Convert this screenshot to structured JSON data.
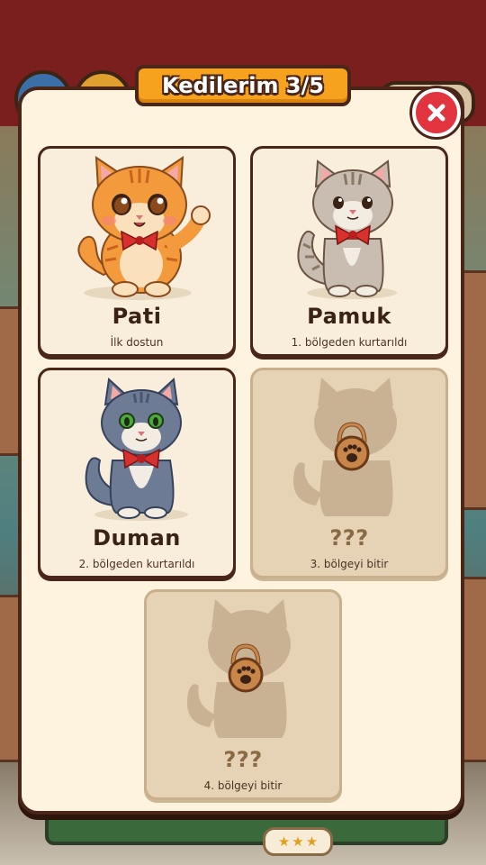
{
  "modal": {
    "title": "Kedilerim 3/5"
  },
  "cats": [
    {
      "name": "Pati",
      "subtitle": "İlk dostun",
      "locked": false,
      "fur": "#f29a3c",
      "eyes": "#8a4a1c"
    },
    {
      "name": "Pamuk",
      "subtitle": "1. bölgeden kurtarıldı",
      "locked": false,
      "fur": "#c8bdb0",
      "eyes": "#6a4a30"
    },
    {
      "name": "Duman",
      "subtitle": "2. bölgeden kurtarıldı",
      "locked": false,
      "fur": "#6d7c94",
      "eyes": "#4caa3c"
    },
    {
      "name": "???",
      "subtitle": "3. bölgeyi bitir",
      "locked": true
    },
    {
      "name": "???",
      "subtitle": "4. bölgeyi bitir",
      "locked": true
    }
  ],
  "colors": {
    "accent": "#f6a21e",
    "close": "#e2343e",
    "bow": "#d8302c",
    "lock": "#c8864a",
    "silhouette": "#c9b294"
  },
  "icons": {
    "close": "close-icon",
    "lock": "padlock-paw-icon",
    "stars": "star-icon"
  }
}
